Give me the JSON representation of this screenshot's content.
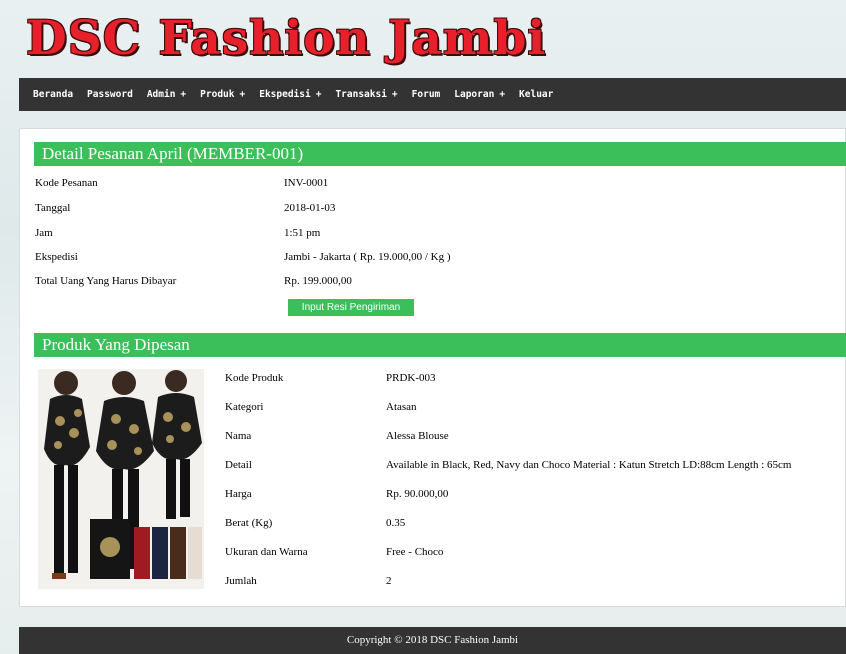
{
  "site": {
    "logo_text": "DSC Fashion Jambi"
  },
  "nav": {
    "items": [
      {
        "label": "Beranda",
        "plus": ""
      },
      {
        "label": "Password",
        "plus": ""
      },
      {
        "label": "Admin",
        "plus": "+"
      },
      {
        "label": "Produk",
        "plus": "+"
      },
      {
        "label": "Ekspedisi",
        "plus": "+"
      },
      {
        "label": "Transaksi",
        "plus": "+"
      },
      {
        "label": "Forum",
        "plus": ""
      },
      {
        "label": "Laporan",
        "plus": "+"
      },
      {
        "label": "Keluar",
        "plus": ""
      }
    ]
  },
  "order": {
    "header": "Detail Pesanan April (MEMBER-001)",
    "rows": [
      {
        "label": "Kode Pesanan",
        "value": "INV-0001"
      },
      {
        "label": "Tanggal",
        "value": "2018-01-03"
      },
      {
        "label": "Jam",
        "value": "1:51 pm"
      },
      {
        "label": "Ekspedisi",
        "value": "Jambi - Jakarta ( Rp. 19.000,00 / Kg )"
      },
      {
        "label": "Total Uang Yang Harus Dibayar",
        "value": "Rp. 199.000,00"
      }
    ],
    "button_label": "Input Resi Pengiriman"
  },
  "products": {
    "header": "Produk Yang Dipesan",
    "rows": [
      {
        "label": "Kode Produk",
        "value": "PRDK-003"
      },
      {
        "label": "Kategori",
        "value": "Atasan"
      },
      {
        "label": "Nama",
        "value": "Alessa Blouse"
      },
      {
        "label": "Detail",
        "value": "Available in Black, Red, Navy dan Choco Material : Katun Stretch LD:88cm Length : 65cm"
      },
      {
        "label": "Harga",
        "value": "Rp. 90.000,00"
      },
      {
        "label": "Berat (Kg)",
        "value": "0.35"
      },
      {
        "label": "Ukuran dan Warna",
        "value": "Free - Choco"
      },
      {
        "label": "Jumlah",
        "value": "2"
      }
    ]
  },
  "footer": {
    "text": "Copyright © 2018 DSC Fashion Jambi"
  },
  "colors": {
    "accent": "#3bbf5a",
    "navbar": "#333333",
    "logo": "#e8202b"
  }
}
